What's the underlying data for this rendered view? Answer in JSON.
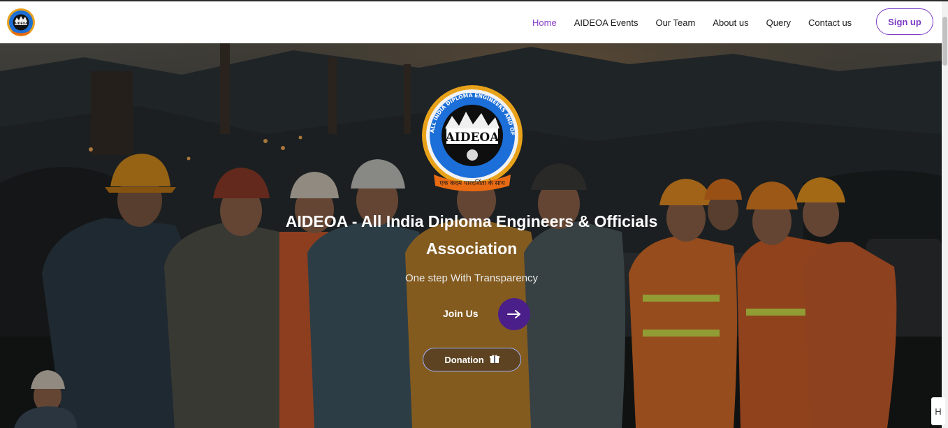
{
  "brand": {
    "logo_text": "AIDEOA",
    "ring_text": "ALL INDIA DIPLOMA ENGINEERS AND OFFICIALS ASSOCIATION",
    "ribbon_text": "एक कदम पारदर्शिता के साथ"
  },
  "nav": {
    "items": [
      {
        "label": "Home",
        "active": true
      },
      {
        "label": "AIDEOA Events",
        "active": false
      },
      {
        "label": "Our Team",
        "active": false
      },
      {
        "label": "About us",
        "active": false
      },
      {
        "label": "Query",
        "active": false
      },
      {
        "label": "Contact us",
        "active": false
      }
    ],
    "signup_label": "Sign up"
  },
  "hero": {
    "title_line1": "AIDEOA - All India Diploma Engineers & Officials",
    "title_line2": "Association",
    "subtitle": "One step With Transparency",
    "join_label": "Join Us",
    "donation_label": "Donation"
  },
  "colors": {
    "accent": "#7b3ac4",
    "nav_active": "#8a3fc8",
    "join_circle": "#4b1f8a",
    "donation_border": "#9fb3ff"
  },
  "icons": {
    "join": "arrow-right-icon",
    "donation": "gift-icon",
    "corner": "h-icon"
  },
  "corner_widget_label": "H"
}
